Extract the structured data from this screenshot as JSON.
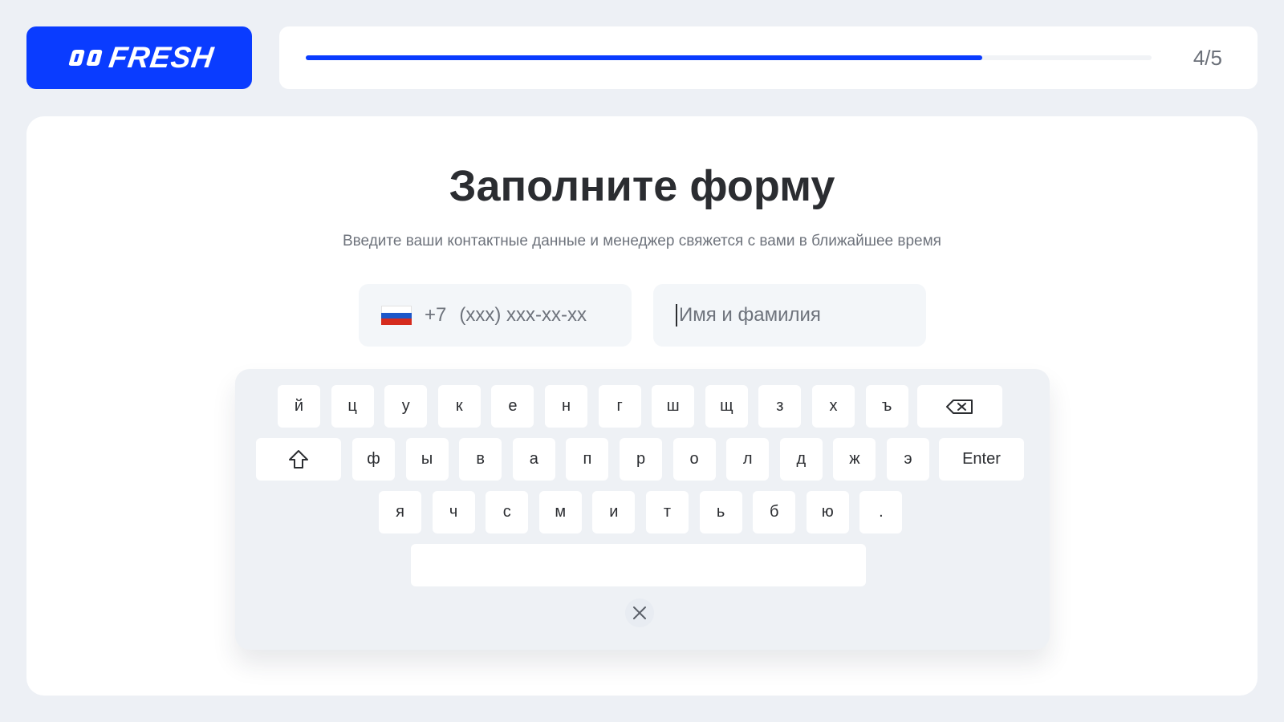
{
  "logo": {
    "text": "FRESH"
  },
  "progress": {
    "fraction": 0.8,
    "label": "4/5"
  },
  "form": {
    "title": "Заполните форму",
    "subtitle": "Введите ваши контактные данные и менеджер свяжется с вами в ближайшее время",
    "phone": {
      "code": "+7",
      "placeholder": "(xxx) xxx-xx-xx",
      "flag": "russia-flag-icon"
    },
    "name": {
      "placeholder": "Имя и фамилия"
    }
  },
  "keyboard": {
    "row1": [
      "й",
      "ц",
      "у",
      "к",
      "е",
      "н",
      "г",
      "ш",
      "щ",
      "з",
      "х",
      "ъ"
    ],
    "row2": [
      "ф",
      "ы",
      "в",
      "а",
      "п",
      "р",
      "о",
      "л",
      "д",
      "ж",
      "э"
    ],
    "row3": [
      "я",
      "ч",
      "с",
      "м",
      "и",
      "т",
      "ь",
      "б",
      "ю",
      "."
    ],
    "enter_label": "Enter",
    "icons": {
      "backspace": "backspace-icon",
      "shift": "shift-icon",
      "close": "close-icon"
    }
  },
  "colors": {
    "accent": "#0a3cff",
    "background": "#edf0f5",
    "field": "#f3f6f9",
    "keyboard": "#eef1f5"
  }
}
